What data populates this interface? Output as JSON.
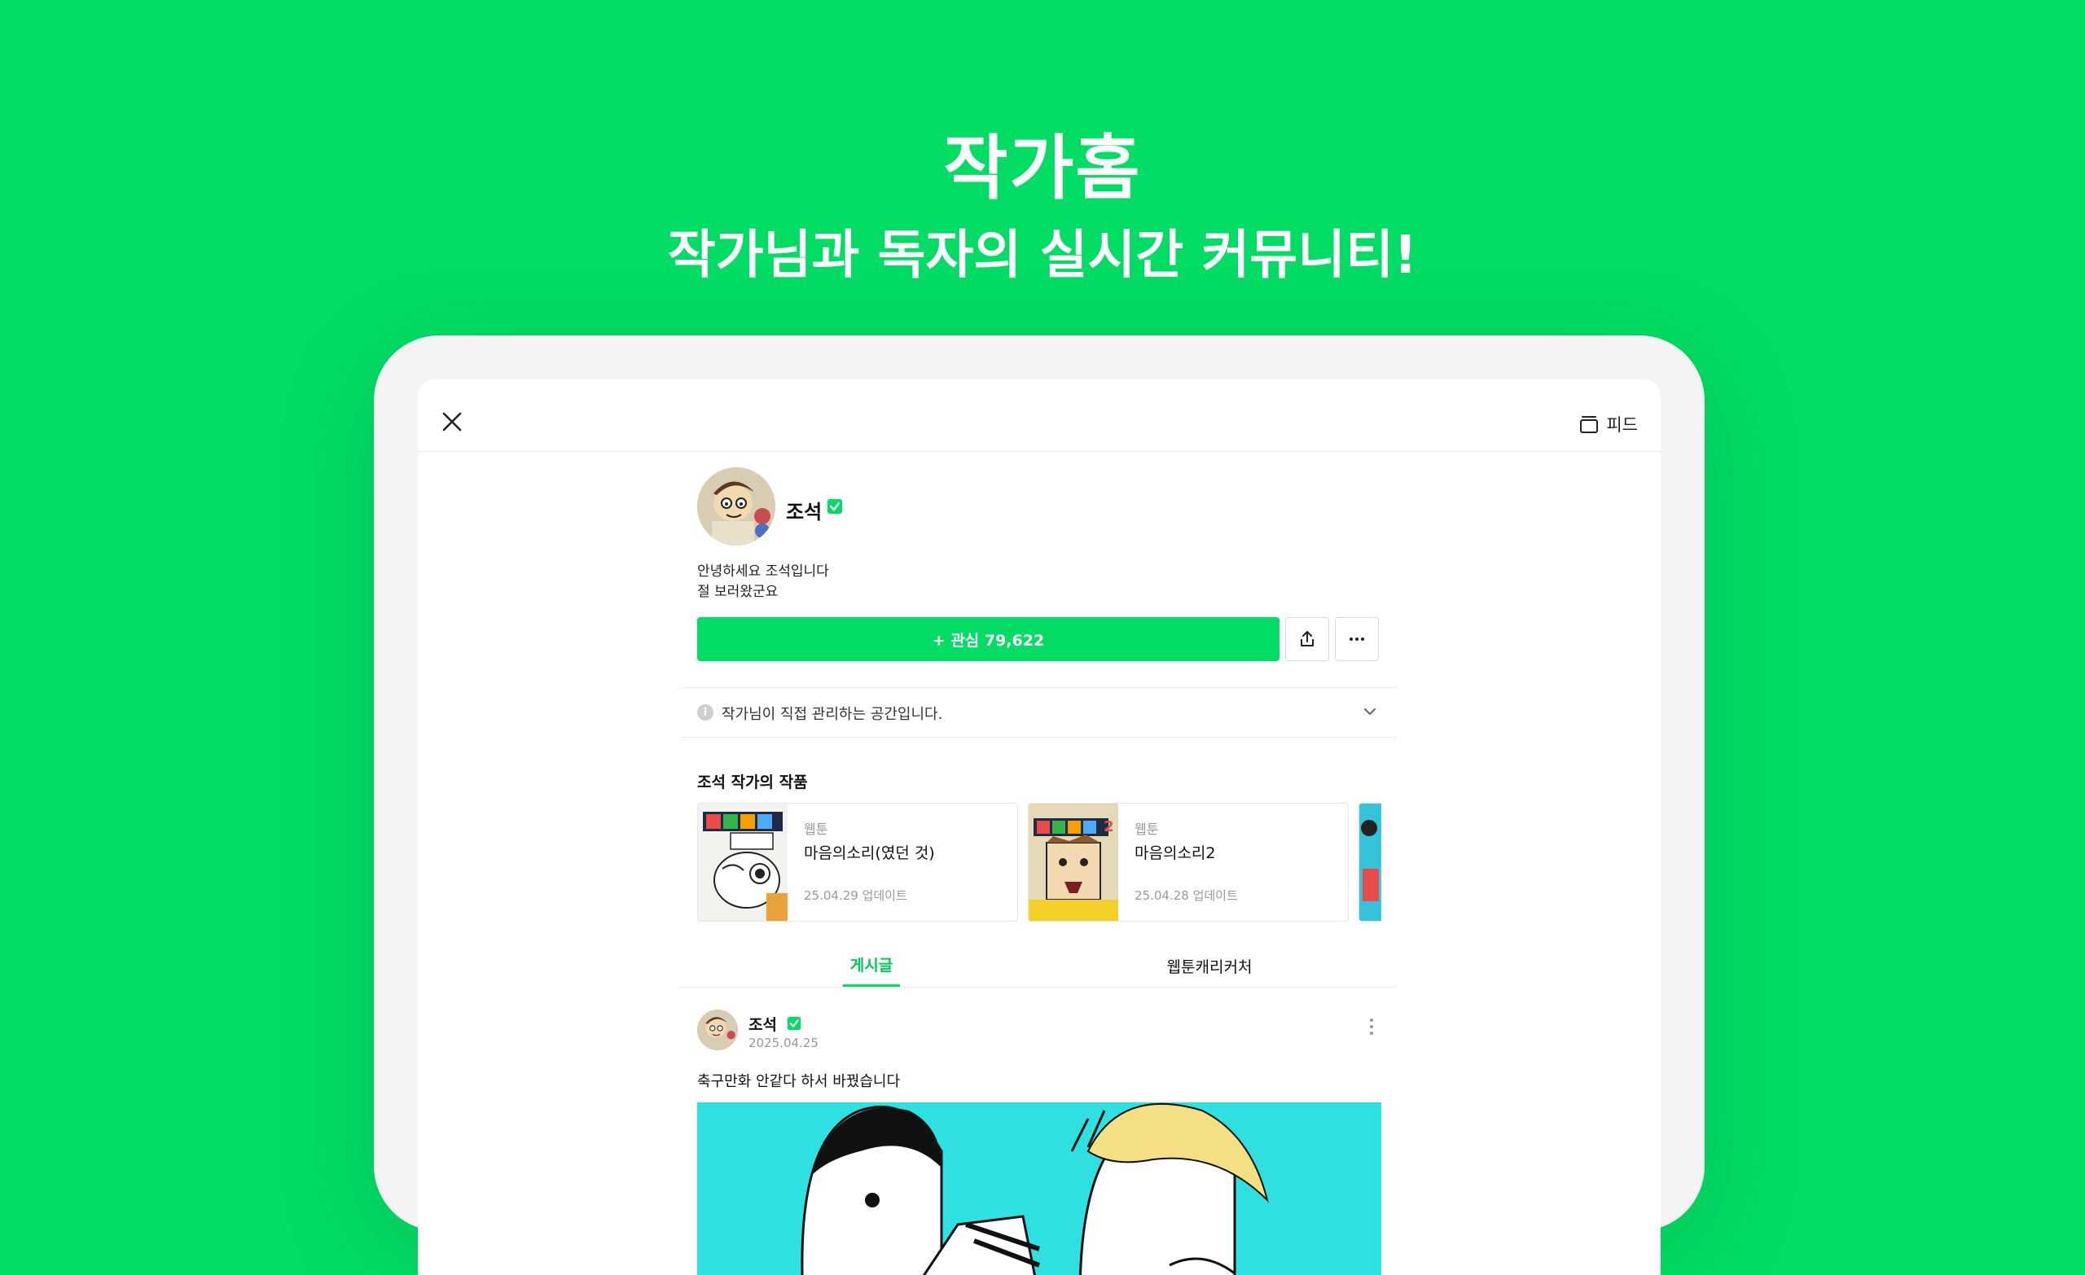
{
  "promo": {
    "title": "작가홈",
    "subtitle": "작가님과 독자의 실시간 커뮤니티!"
  },
  "topbar": {
    "close_icon": "close-icon",
    "feed_icon": "stack-icon",
    "feed_label": "피드"
  },
  "profile": {
    "name": "조석",
    "bio_line1": "안녕하세요 조석입니다",
    "bio_line2": "절 보러왔군요",
    "follow_label": "+ 관심 79,622",
    "share_icon": "share-icon",
    "more_icon": "more-icon"
  },
  "notice": {
    "text": "작가님이 직접 관리하는 공간입니다."
  },
  "works": {
    "section_title": "조석 작가의 작품",
    "items": [
      {
        "type": "웹툰",
        "title": "마음의소리(였던 것)",
        "date": "25.04.29 업데이트"
      },
      {
        "type": "웹툰",
        "title": "마음의소리2",
        "date": "25.04.28 업데이트"
      }
    ]
  },
  "tabs": {
    "posts": "게시글",
    "caricature": "웹툰캐리커처"
  },
  "post": {
    "author": "조석",
    "date": "2025.04.25",
    "body": "축구만화 안같다 하서 바꿨습니다"
  },
  "colors": {
    "brand_green": "#00DC64",
    "background": "#00DC64"
  }
}
